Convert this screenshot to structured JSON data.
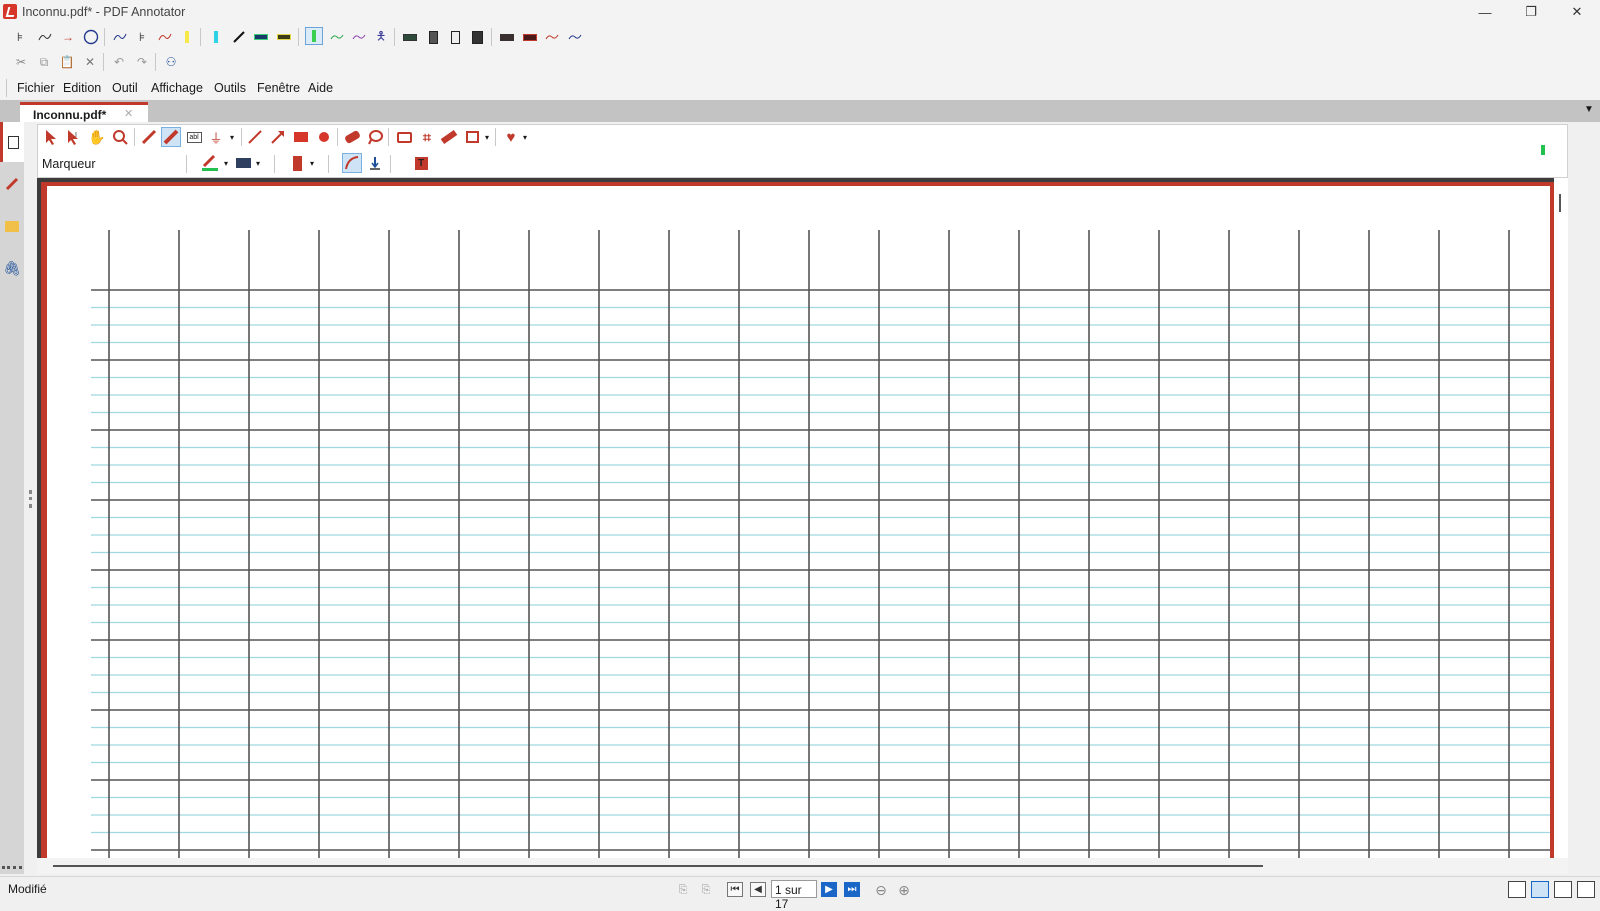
{
  "window": {
    "title": "Inconnu.pdf* - PDF Annotator",
    "controls": [
      "minimize",
      "restore",
      "close"
    ]
  },
  "quick_toolbar_row1": {
    "icons": [
      "pointer-tool-icon",
      "freehand-icon",
      "arrow-icon",
      "circle-icon",
      "squiggle-icon",
      "pointer-alt-icon",
      "squiggle-icon",
      "highlighter-yellow-icon",
      "highlighter-cyan-icon",
      "pen-icon",
      "label-green-icon",
      "label-yellow-icon",
      "selected-marker-icon",
      "wave-green-icon",
      "wave-purple-icon",
      "stamp-figure-icon",
      "label-dark-icon",
      "portrait-a-icon",
      "portrait-b-icon",
      "portrait-c-icon",
      "label-black-icon",
      "label-red-icon",
      "wave-red-icon",
      "wave-blue-icon"
    ]
  },
  "quick_toolbar_row2": {
    "icons": [
      "cut-icon",
      "copy-icon",
      "paste-icon",
      "delete-icon",
      "undo-icon",
      "redo-icon",
      "binoculars-icon"
    ]
  },
  "menu": {
    "items": [
      "Fichier",
      "Edition",
      "Outil",
      "Affichage",
      "Outils",
      "Fenêtre",
      "Aide"
    ]
  },
  "tabs": [
    {
      "label": "Inconnu.pdf*",
      "active": true
    }
  ],
  "sidebar": {
    "tabs": [
      "pages-icon",
      "annotations-pen-icon",
      "folder-icon",
      "attachment-icon"
    ]
  },
  "annotation_toolbar": {
    "row1_icons": [
      "select-arrow-icon",
      "select-text-icon",
      "hand-icon",
      "zoom-icon",
      "pen-tool-icon",
      "marker-tool-icon",
      "text-box-icon",
      "stamp-icon",
      "line-icon",
      "arrow-tool-icon",
      "rectangle-icon",
      "ellipse-icon",
      "eraser-icon",
      "lasso-icon",
      "camera-icon",
      "crop-icon",
      "ruler-icon",
      "insert-image-icon",
      "favorite-heart-icon"
    ],
    "current_tool_label": "Marqueur",
    "row2_icons": [
      "color-picker-icon",
      "fill-color-icon",
      "line-width-icon",
      "smooth-line-icon",
      "straighten-icon",
      "insert-text-icon"
    ],
    "accent_color": "#c0392b",
    "indicator_color": "#21c04f"
  },
  "page": {
    "paper": "french-ruled-seyes",
    "grid_color": "#555555",
    "line_color": "#9fd8e0",
    "border_color": "#c0392b"
  },
  "status": {
    "text": "Modifié",
    "page_indicator": "1 sur 17",
    "current_page": 1,
    "page_count": 17
  },
  "navigation": {
    "buttons": [
      "first-page",
      "previous-page",
      "next-page",
      "last-page",
      "back",
      "forward"
    ]
  }
}
